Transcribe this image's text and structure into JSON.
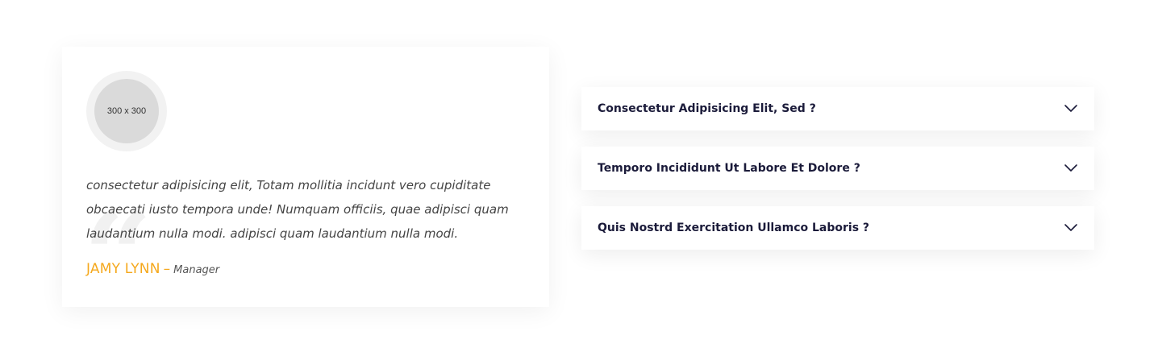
{
  "testimonial": {
    "avatar_placeholder": "300 x 300",
    "quote_mark": "“",
    "quote": "consectetur adipisicing elit, Totam mollitia incidunt vero cupiditate obcaecati iusto tempora unde! Numquam officiis, quae adipisci quam laudantium nulla modi. adipisci quam laudantium nulla modi.",
    "author_name": "JAMY LYNN",
    "author_separator": "–",
    "author_role": "Manager"
  },
  "accordion": {
    "items": [
      {
        "title": "Consectetur Adipisicing Elit, Sed ?",
        "icon": "chevron-down-icon"
      },
      {
        "title": "Temporo Incididunt Ut Labore Et Dolore ?",
        "icon": "chevron-down-icon"
      },
      {
        "title": "Quis Nostrd Exercitation Ullamco Laboris ?",
        "icon": "chevron-down-icon"
      }
    ]
  },
  "colors": {
    "accent": "#f5a81c",
    "heading": "#1b1b3a",
    "body_text": "#444444"
  }
}
